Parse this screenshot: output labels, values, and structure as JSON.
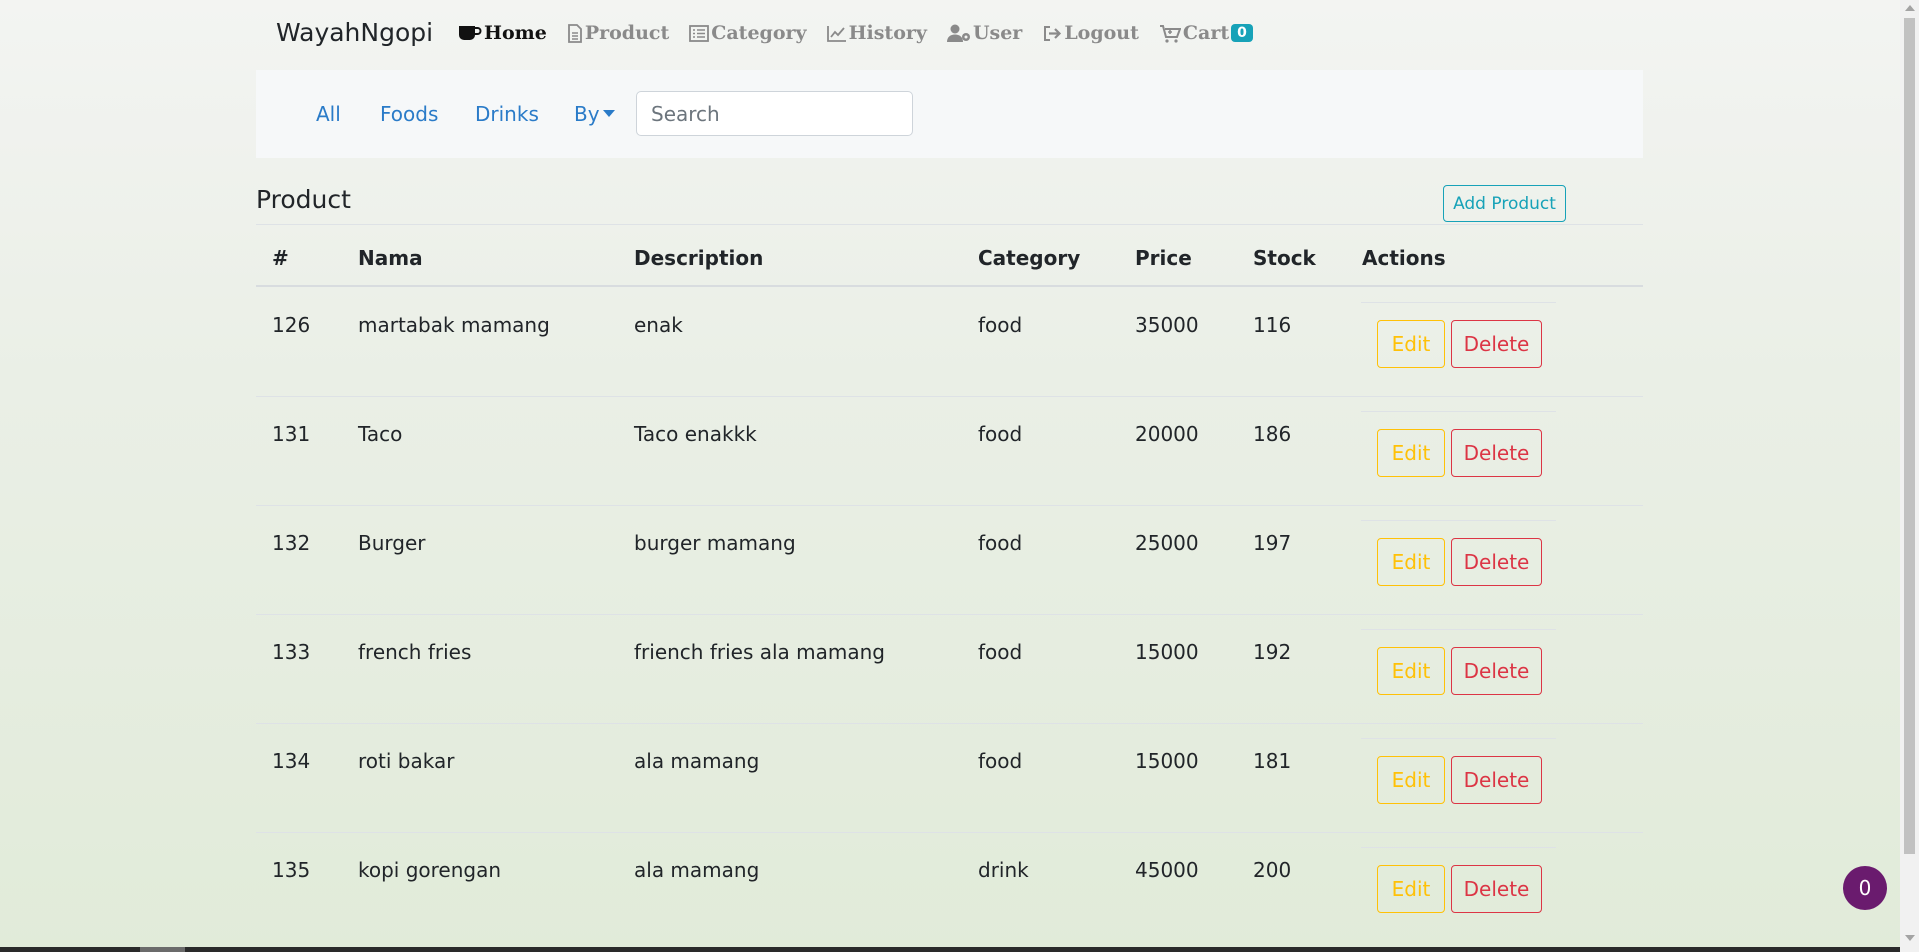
{
  "brand": "WayahNgopi",
  "nav": [
    {
      "label": "Home",
      "icon": "coffee-cup-icon",
      "active": true
    },
    {
      "label": "Product",
      "icon": "document-icon",
      "active": false
    },
    {
      "label": "Category",
      "icon": "list-icon",
      "active": false
    },
    {
      "label": "History",
      "icon": "line-chart-icon",
      "active": false
    },
    {
      "label": "User",
      "icon": "user-gear-icon",
      "active": false
    },
    {
      "label": "Logout",
      "icon": "logout-icon",
      "active": false
    },
    {
      "label": "Cart",
      "icon": "cart-icon",
      "active": false,
      "badge": "0"
    }
  ],
  "filters": {
    "all": "All",
    "foods": "Foods",
    "drinks": "Drinks",
    "by": "By",
    "search_placeholder": "Search"
  },
  "page_title": "Product",
  "add_button": "Add Product",
  "table": {
    "headers": [
      "#",
      "Nama",
      "Description",
      "Category",
      "Price",
      "Stock",
      "Actions"
    ],
    "rows": [
      {
        "id": "126",
        "nama": "martabak mamang",
        "description": "enak",
        "category": "food",
        "price": "35000",
        "stock": "116"
      },
      {
        "id": "131",
        "nama": "Taco",
        "description": "Taco enakkk",
        "category": "food",
        "price": "20000",
        "stock": "186"
      },
      {
        "id": "132",
        "nama": "Burger",
        "description": "burger mamang",
        "category": "food",
        "price": "25000",
        "stock": "197"
      },
      {
        "id": "133",
        "nama": "french fries",
        "description": "friench fries ala mamang",
        "category": "food",
        "price": "15000",
        "stock": "192"
      },
      {
        "id": "134",
        "nama": "roti bakar",
        "description": "ala mamang",
        "category": "food",
        "price": "15000",
        "stock": "181"
      },
      {
        "id": "135",
        "nama": "kopi gorengan",
        "description": "ala mamang",
        "category": "drink",
        "price": "45000",
        "stock": "200"
      }
    ],
    "edit_label": "Edit",
    "delete_label": "Delete"
  },
  "floating_badge": "0",
  "colors": {
    "accent": "#2a7bc8",
    "info": "#17a2b8",
    "warning": "#ffc107",
    "danger": "#dc3545",
    "badge_bg": "#6a1b6e"
  }
}
